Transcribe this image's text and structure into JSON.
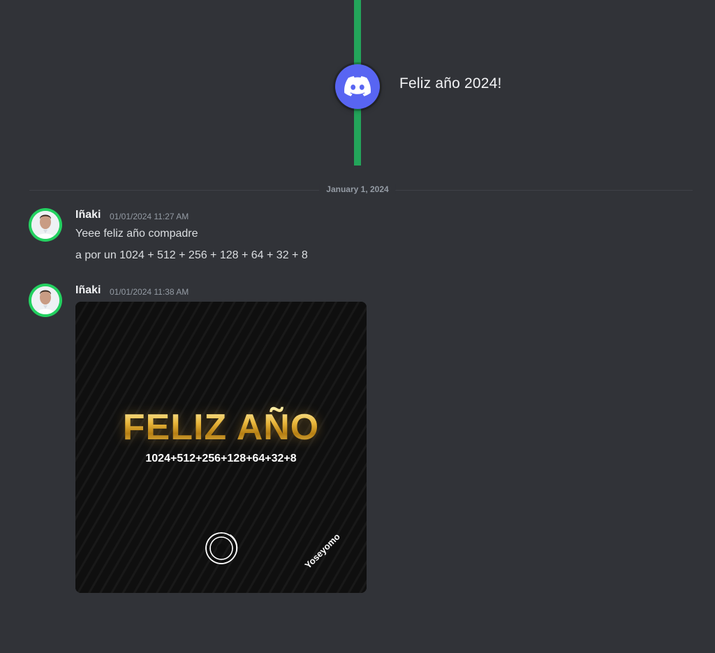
{
  "system_event": {
    "text": "Feliz año 2024!",
    "icon": "discord-logo-icon",
    "accent_color": "#5865f2",
    "line_color": "#23a55a"
  },
  "date_divider": {
    "label": "January 1, 2024"
  },
  "messages": [
    {
      "username": "Iñaki",
      "timestamp": "01/01/2024 11:27 AM",
      "lines": [
        "Yeee feliz año compadre",
        "a por un 1024 + 512 + 256 + 128 + 64 + 32 + 8"
      ]
    },
    {
      "username": "Iñaki",
      "timestamp": "01/01/2024 11:38 AM",
      "attachment": {
        "headline": "FELIZ AÑO",
        "formula": "1024+512+256+128+64+32+8",
        "brand": "Yoseyomo"
      }
    }
  ]
}
